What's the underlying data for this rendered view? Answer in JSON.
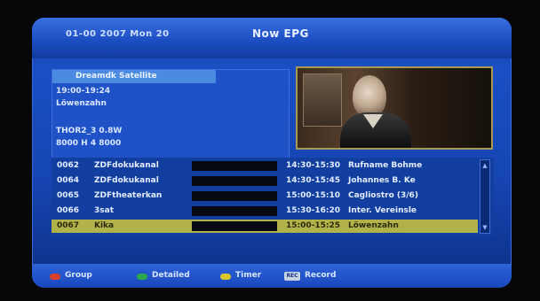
{
  "header": {
    "datetime": "01-00 2007 Mon 20",
    "title": "Now EPG"
  },
  "program_info": {
    "title": "Dreamdk Satellite",
    "time": "19:00-19:24",
    "event": "Löwenzahn",
    "transponder": "THOR2_3 0.8W",
    "frequency": "8000 H 4 8000"
  },
  "channels": [
    {
      "num": "0062",
      "name": "ZDFdokukanal",
      "time": "14:30-15:30",
      "event": "Rufname Bohme"
    },
    {
      "num": "0064",
      "name": "ZDFdokukanal",
      "time": "14:30-15:45",
      "event": "Johannes B. Ke"
    },
    {
      "num": "0065",
      "name": "ZDFtheaterkan",
      "time": "15:00-15:10",
      "event": "Cagliostro (3/6)"
    },
    {
      "num": "0066",
      "name": "3sat",
      "time": "15:30-16:20",
      "event": "Inter. Vereinsle"
    },
    {
      "num": "0067",
      "name": "Kika",
      "time": "15:00-15:25",
      "event": "Löwenzahn",
      "selected": true
    }
  ],
  "footer": {
    "keys": [
      {
        "label": "Group",
        "color": "#d8402a"
      },
      {
        "label": "Detailed",
        "color": "#2aa84c"
      },
      {
        "label": "Timer",
        "color": "#d8c82a"
      },
      {
        "label": "Record",
        "icon": "record-key-icon",
        "icon_text": "REC"
      }
    ]
  },
  "colors": {
    "panel": "#1f52c6",
    "selected_row": "#b1b24a",
    "title_highlight": "#4a8ae0"
  }
}
